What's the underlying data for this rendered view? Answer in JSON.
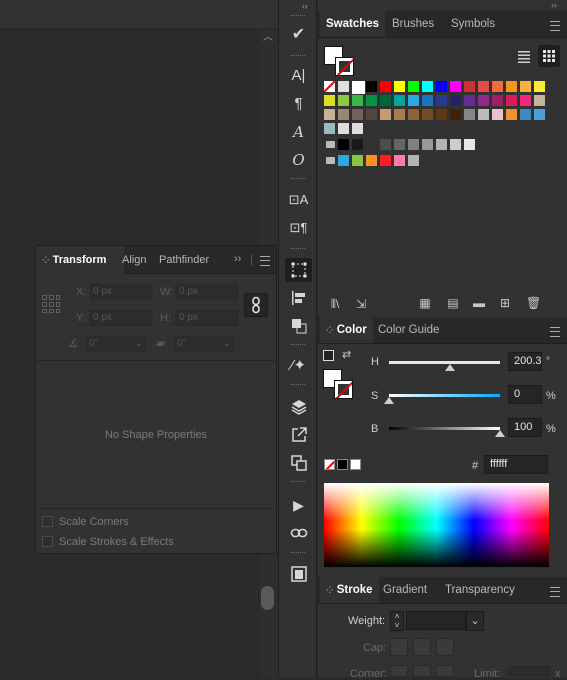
{
  "transform": {
    "tabs": [
      "Transform",
      "Align",
      "Pathfinder"
    ],
    "x_label": "X:",
    "x_placeholder": "0 px",
    "y_label": "Y:",
    "y_placeholder": "0 px",
    "w_label": "W:",
    "w_placeholder": "0 px",
    "h_label": "H:",
    "h_placeholder": "0 px",
    "rotate_value": "0°",
    "shear_value": "0°",
    "empty_text": "No Shape Properties",
    "scale_corners": "Scale Corners",
    "scale_strokes": "Scale Strokes & Effects"
  },
  "swatches": {
    "tabs": [
      "Swatches",
      "Brushes",
      "Symbols"
    ],
    "rows": [
      [
        "#ffffff",
        "#e0e0e0",
        "#ffffff",
        "#000000",
        "#ff0000",
        "#ffff00",
        "#00ff00",
        "#00ffff",
        "#0000ff",
        "#ff00ff",
        "#cc3333",
        "#e84a4a",
        "#f26b3a",
        "#f7941d",
        "#fbb040",
        "#f9ed32"
      ],
      [
        "#d7e021",
        "#8dc63f",
        "#39b54a",
        "#009444",
        "#006838",
        "#00a79d",
        "#27aae1",
        "#1c75bc",
        "#2b3990",
        "#262262",
        "#662d91",
        "#92278f",
        "#9e1f63",
        "#da1c5c",
        "#ee2a7b",
        "#c2b59b"
      ],
      [
        "#c7b299",
        "#998675",
        "#736357",
        "#534741",
        "#c69c6d",
        "#a67c52",
        "#8c6239",
        "#754c24",
        "#603813",
        "#42210b",
        "#888888",
        "#bbbbbb",
        "#e8c0d0",
        "#f09030",
        "#3c8ac0",
        "#4f9fd6"
      ]
    ],
    "grey_row": [
      "#000000",
      "#1a1a1a",
      "#333333",
      "#4d4d4d",
      "#666666",
      "#808080",
      "#999999",
      "#b3b3b3",
      "#cccccc",
      "#e6e6e6"
    ],
    "color_group_row": [
      "#29abe2",
      "#8cc63f",
      "#f7931e",
      "#ff1d25",
      "#ff7bac",
      "#b3b3b3"
    ]
  },
  "color": {
    "tabs": [
      "Color",
      "Color Guide"
    ],
    "h_label": "H",
    "h_value": "200.3",
    "h_unit": "°",
    "s_label": "S",
    "s_value": "0",
    "s_unit": "%",
    "b_label": "B",
    "b_value": "100",
    "b_unit": "%",
    "hash": "#",
    "hex_value": "ffffff",
    "fill_color": "#ffffff"
  },
  "stroke": {
    "tabs": [
      "Stroke",
      "Gradient",
      "Transparency"
    ],
    "weight_label": "Weight:",
    "cap_label": "Cap:",
    "corner_label": "Corner:",
    "limit_label": "Limit:",
    "x_mark": "x"
  }
}
